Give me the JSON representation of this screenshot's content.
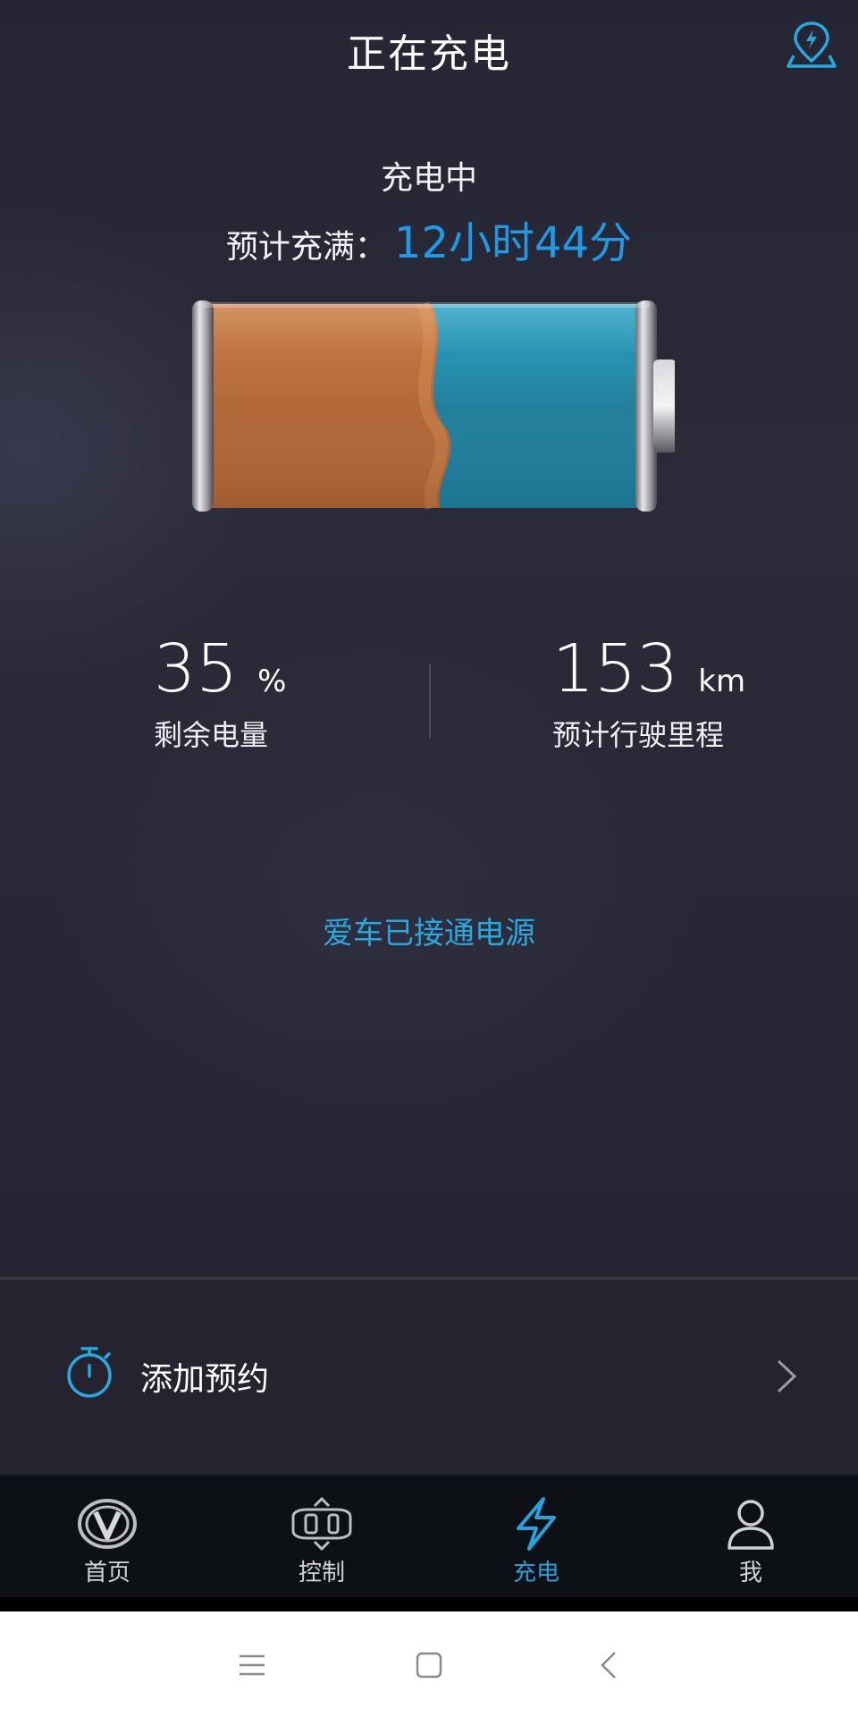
{
  "header": {
    "title": "正在充电",
    "map_button_icon": "charging-map-pin-icon"
  },
  "charging": {
    "status": "充电中",
    "eta_label": "预计充满：",
    "eta_value": "12小时44分",
    "battery_level_fraction": 0.35
  },
  "stats": {
    "battery": {
      "value": "35",
      "unit": "%",
      "label": "剩余电量"
    },
    "range": {
      "value": "153",
      "unit": "km",
      "label": "预计行驶里程"
    }
  },
  "connection_status": "爱车已接通电源",
  "reserve": {
    "label": "添加预约",
    "icon": "stopwatch-icon",
    "arrow_icon": "chevron-right-icon"
  },
  "tabs": [
    {
      "label": "首页",
      "icon": "changan-logo-icon",
      "active": false
    },
    {
      "label": "控制",
      "icon": "car-control-icon",
      "active": false
    },
    {
      "label": "充电",
      "icon": "lightning-icon",
      "active": true
    },
    {
      "label": "我",
      "icon": "person-icon",
      "active": false
    }
  ],
  "colors": {
    "accent_blue": "#1e9be6",
    "tab_active": "#24a3dd",
    "battery_orange": "#c96f35",
    "battery_blue": "#1f8fb0"
  },
  "system_nav": {
    "icons": [
      "menu-icon",
      "home-square-icon",
      "back-icon"
    ]
  }
}
